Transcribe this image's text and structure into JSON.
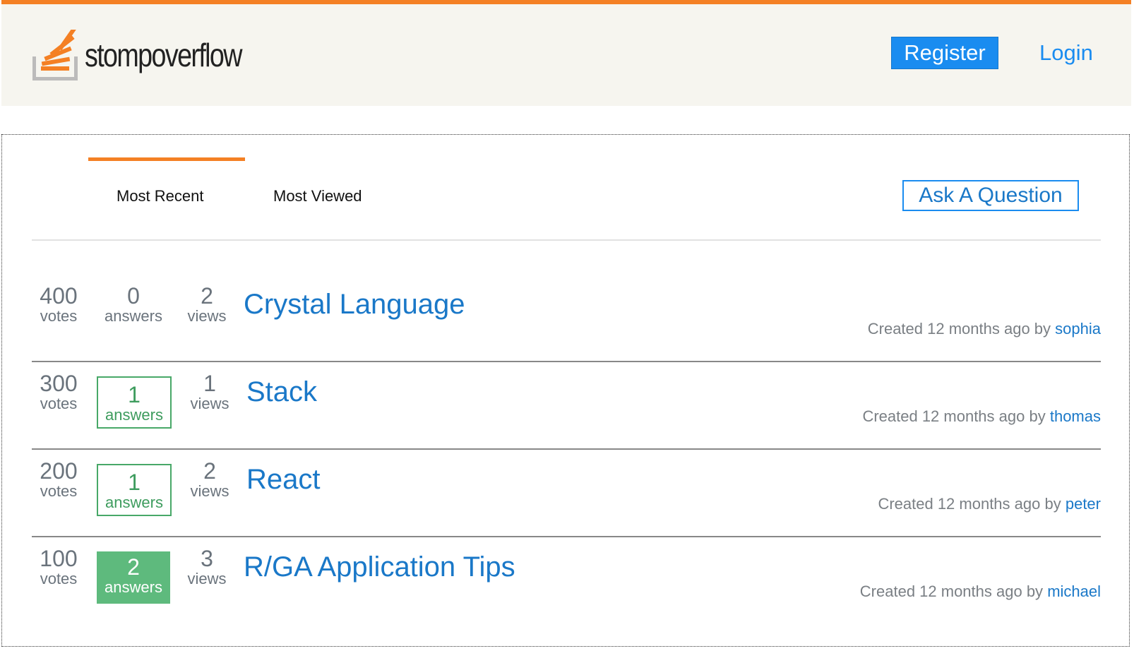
{
  "header": {
    "brand_prefix": "stomp",
    "brand_suffix": "overflow",
    "register_label": "Register",
    "login_label": "Login",
    "accent_color": "#f48024",
    "link_color": "#1a8cf0"
  },
  "tabs": [
    {
      "label": "Most Recent",
      "active": true
    },
    {
      "label": "Most Viewed",
      "active": false
    }
  ],
  "ask_button": "Ask A Question",
  "stat_labels": {
    "votes": "votes",
    "answers": "answers",
    "views": "views"
  },
  "meta_prefix": "Created 12 months ago by",
  "questions": [
    {
      "votes": "400",
      "answers": "0",
      "views": "2",
      "title": "Crystal Language",
      "author": "sophia",
      "answers_style": "none"
    },
    {
      "votes": "300",
      "answers": "1",
      "views": "1",
      "title": "Stack",
      "author": "thomas",
      "answers_style": "outline"
    },
    {
      "votes": "200",
      "answers": "1",
      "views": "2",
      "title": "React",
      "author": "peter",
      "answers_style": "outline"
    },
    {
      "votes": "100",
      "answers": "2",
      "views": "3",
      "title": "R/GA Application Tips",
      "author": "michael",
      "answers_style": "filled"
    }
  ]
}
